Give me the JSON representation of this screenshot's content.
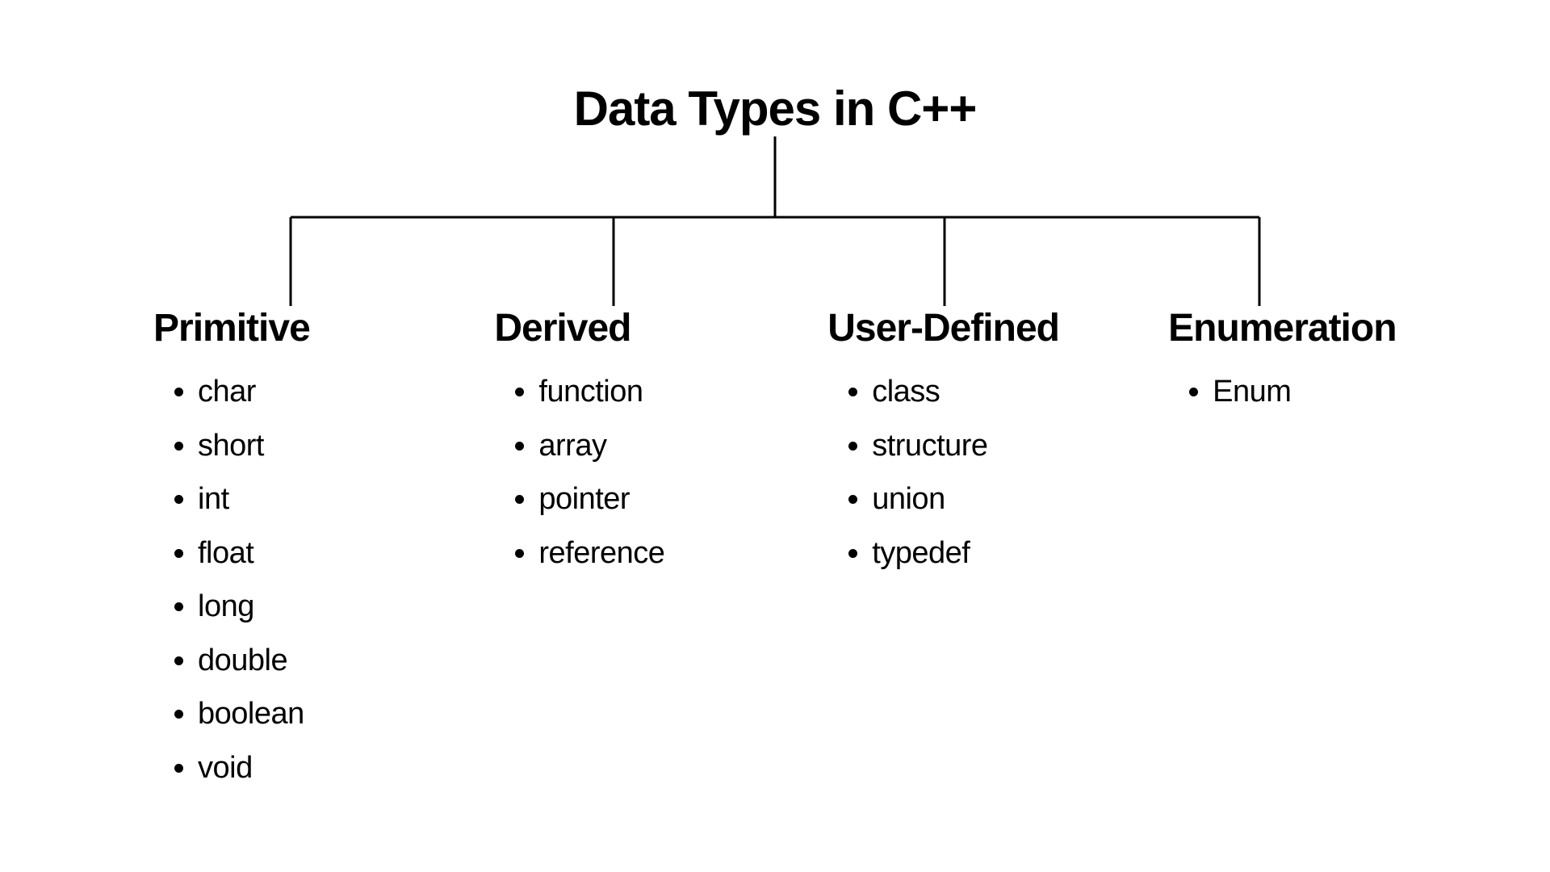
{
  "diagram": {
    "title": "Data Types in C++",
    "categories": [
      {
        "name": "Primitive",
        "items": [
          "char",
          "short",
          "int",
          "float",
          "long",
          "double",
          "boolean",
          "void"
        ]
      },
      {
        "name": "Derived",
        "items": [
          "function",
          "array",
          "pointer",
          "reference"
        ]
      },
      {
        "name": "User-Defined",
        "items": [
          "class",
          "structure",
          "union",
          "typedef"
        ]
      },
      {
        "name": "Enumeration",
        "items": [
          "Enum"
        ]
      }
    ]
  }
}
